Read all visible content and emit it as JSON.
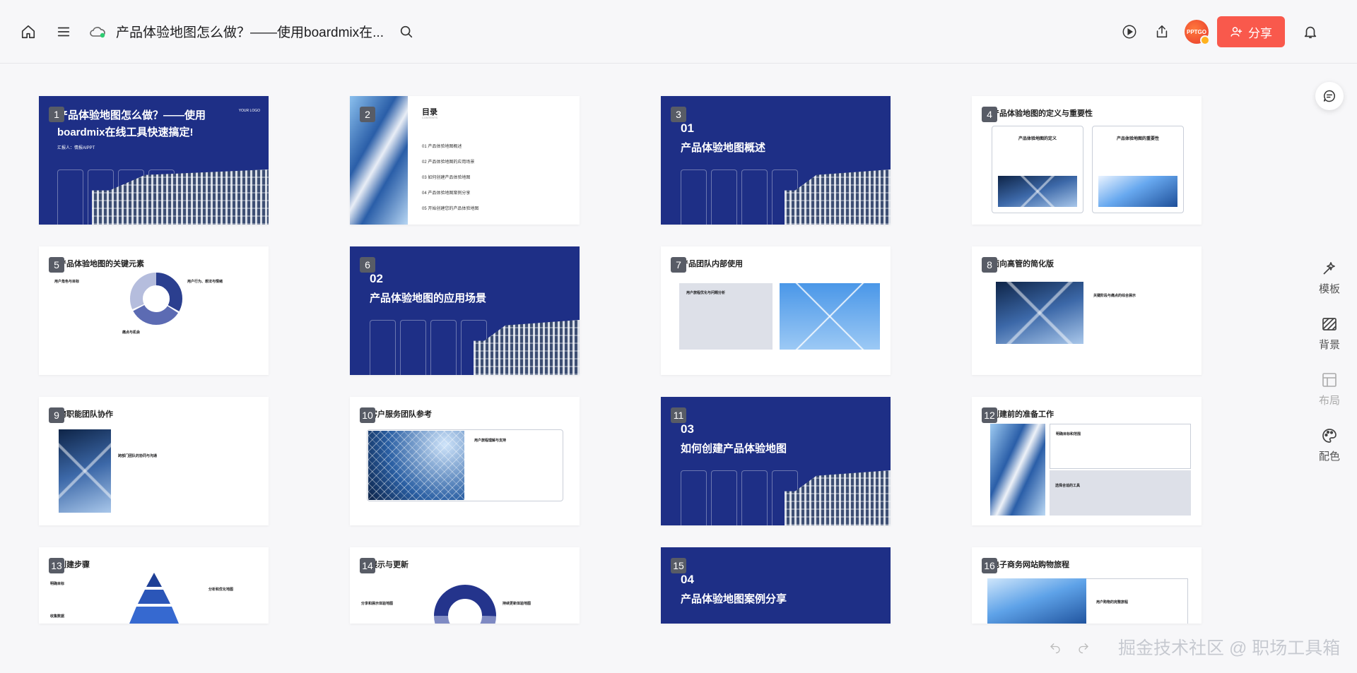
{
  "header": {
    "title": "产品体验地图怎么做？——使用boardmix在...",
    "share_label": "分享",
    "avatar_text": "PPTGO"
  },
  "slides": [
    {
      "num": "1",
      "title": "产品体验地图怎么做？——使用",
      "title2": "boardmix在线工具快速搞定!",
      "reporter": "汇报人：情报AIPPT",
      "tag": "YOUR LOGO"
    },
    {
      "num": "2",
      "title": "目录",
      "subtitle": "CONTENTS",
      "items": [
        "01  产品体验地图概述",
        "02  产品体验地图的应用场景",
        "03  如何创建产品体验地图",
        "04  产品体验地图案例分享",
        "05  开始创建您的产品体验地图"
      ]
    },
    {
      "num": "3",
      "section": "01",
      "title": "产品体验地图概述"
    },
    {
      "num": "4",
      "title": "产品体验地图的定义与重要性",
      "card1": "产品体验地图的定义",
      "card2": "产品体验地图的重要性"
    },
    {
      "num": "5",
      "title": "产品体验地图的关键元素",
      "l1": "用户角色与目标",
      "l2": "用户行为、想法与情绪",
      "l3": "痛点与机会"
    },
    {
      "num": "6",
      "section": "02",
      "title": "产品体验地图的应用场景"
    },
    {
      "num": "7",
      "title": "产品团队内部使用",
      "box": "用户旅程优化与问题分析"
    },
    {
      "num": "8",
      "title": "面向高管的简化版",
      "cap": "关键阶段与痛点的综合展示"
    },
    {
      "num": "9",
      "title": "跨职能团队协作",
      "cap": "跨部门团队的协同与沟通"
    },
    {
      "num": "10",
      "title": "客户服务团队参考",
      "cap": "用户旅程理解与支持"
    },
    {
      "num": "11",
      "section": "03",
      "title": "如何创建产品体验地图"
    },
    {
      "num": "12",
      "title": "创建前的准备工作",
      "c1": "明确目标和范围",
      "c2": "选择合适的工具"
    },
    {
      "num": "13",
      "title": "创建步骤",
      "l1": "明确目标",
      "l2": "收集数据",
      "r1": "分析和优化地图"
    },
    {
      "num": "14",
      "title": "展示与更新",
      "l1": "分享和展示体验地图",
      "r1": "持续更新体验地图"
    },
    {
      "num": "15",
      "section": "04",
      "title": "产品体验地图案例分享"
    },
    {
      "num": "16",
      "title": "电子商务网站购物旅程",
      "cap": "用户购物的完整旅程"
    }
  ],
  "side_tools": [
    {
      "label": "模板"
    },
    {
      "label": "背景"
    },
    {
      "label": "布局"
    },
    {
      "label": "配色"
    }
  ],
  "watermark": "掘金技术社区 @ 职场工具箱"
}
